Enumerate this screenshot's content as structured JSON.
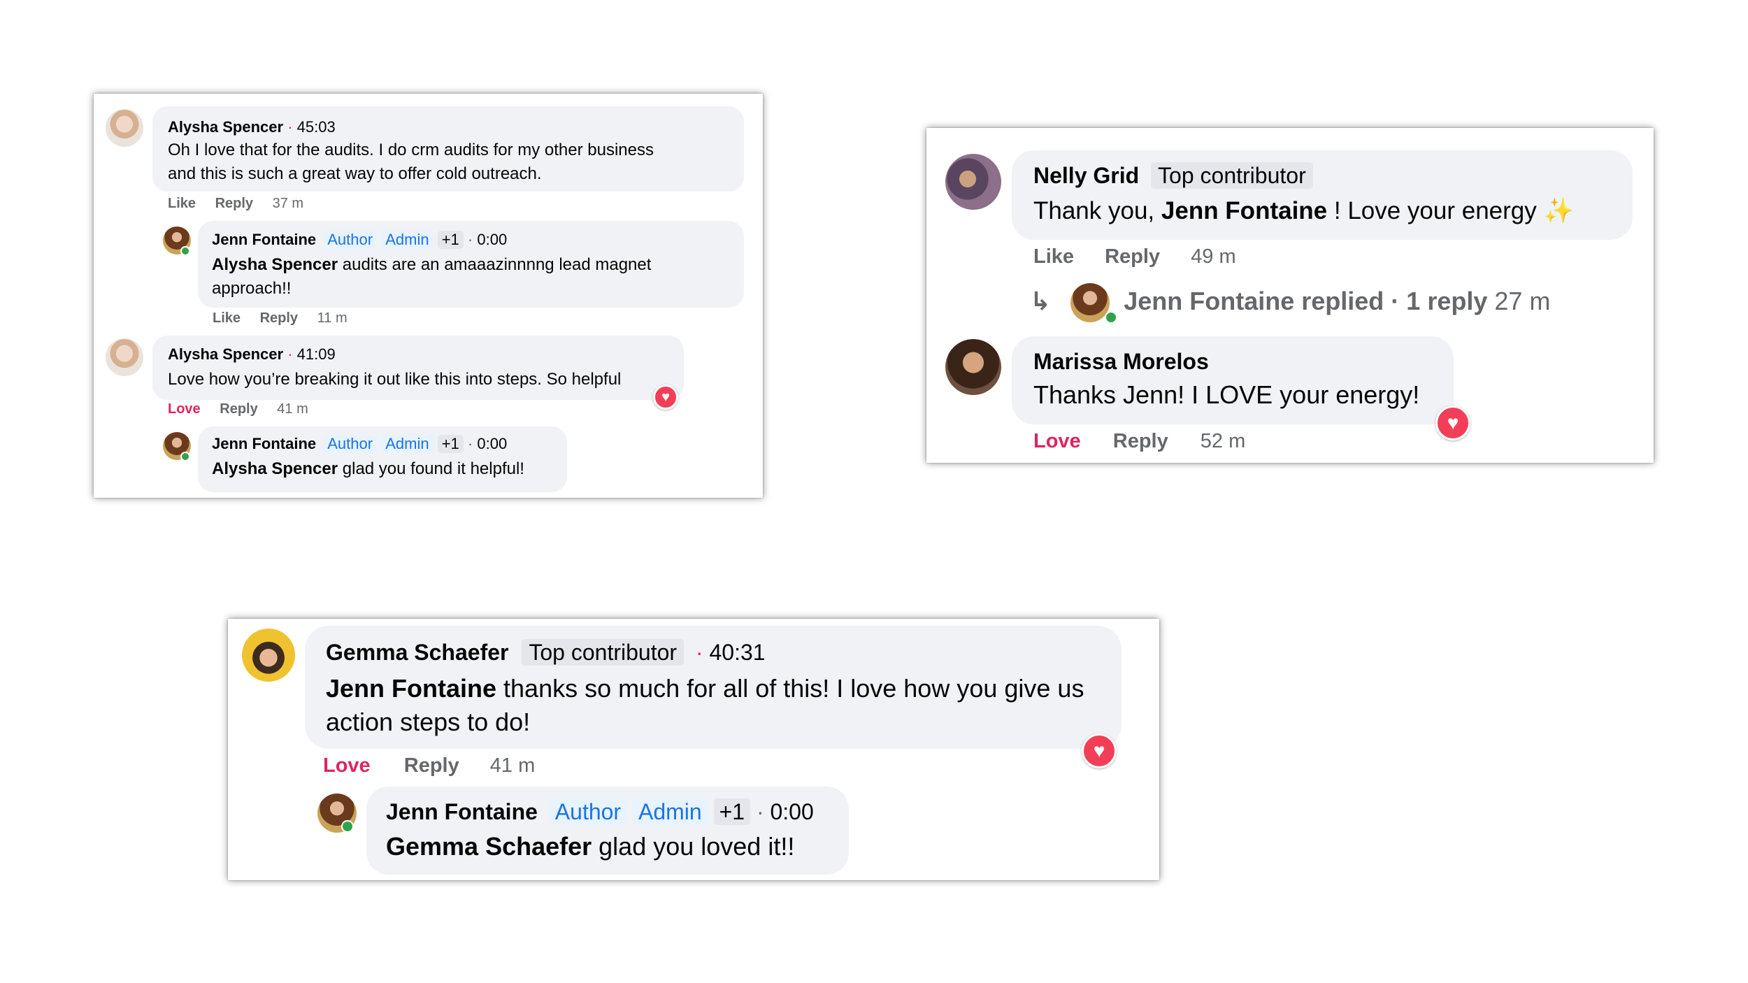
{
  "card1": {
    "comments": [
      {
        "author": "Alysha Spencer",
        "sep": "·",
        "timestamp": "45:03",
        "line1": "Oh I love that for the audits. I do crm audits for my other business",
        "line2": "and this is such a great way to offer cold outreach.",
        "actions": {
          "react": "Like",
          "reply": "Reply",
          "age": "37 m"
        }
      },
      {
        "author": "Jenn Fontaine",
        "badges": [
          "Author",
          "Admin",
          "+1"
        ],
        "sep": "·",
        "timestamp": "0:00",
        "mention": "Alysha Spencer",
        "text_after_mention": " audits are an amaaazinnnng lead magnet",
        "line2": "approach!!",
        "actions": {
          "react": "Like",
          "reply": "Reply",
          "age": "11 m"
        }
      },
      {
        "author": "Alysha Spencer",
        "sep": "·",
        "timestamp": "41:09",
        "line1": "Love how you’re breaking it out like this into steps. So helpful",
        "reaction": "love",
        "actions": {
          "react": "Love",
          "reply": "Reply",
          "age": "41 m"
        }
      },
      {
        "author": "Jenn Fontaine",
        "badges": [
          "Author",
          "Admin",
          "+1"
        ],
        "sep": "·",
        "timestamp": "0:00",
        "mention": "Alysha Spencer",
        "text_after_mention": " glad you found it helpful!"
      }
    ]
  },
  "card2": {
    "comments": [
      {
        "author": "Nelly Grid",
        "badge": "Top contributor",
        "text_before": "Thank you, ",
        "mention": "Jenn Fontaine",
        "text_after": " ! Love your energy ✨",
        "actions": {
          "react": "Like",
          "reply": "Reply",
          "age": "49 m"
        },
        "replies_summary": {
          "name": "Jenn Fontaine replied",
          "sep": "·",
          "count": "1 reply",
          "age": "27 m"
        }
      },
      {
        "author": "Marissa Morelos",
        "text": "Thanks Jenn! I LOVE your energy!",
        "reaction": "love",
        "actions": {
          "react": "Love",
          "reply": "Reply",
          "age": "52 m"
        }
      }
    ]
  },
  "card3": {
    "comments": [
      {
        "author": "Gemma Schaefer",
        "badge": "Top contributor",
        "sep": "·",
        "timestamp": "40:31",
        "mention": "Jenn Fontaine",
        "text_after_mention": " thanks so much for all of this! I love how you give us",
        "line2": "action steps to do!",
        "reaction": "love",
        "actions": {
          "react": "Love",
          "reply": "Reply",
          "age": "41 m"
        }
      },
      {
        "author": "Jenn Fontaine",
        "badges": [
          "Author",
          "Admin",
          "+1"
        ],
        "sep": "·",
        "timestamp": "0:00",
        "mention": "Gemma Schaefer",
        "text_after_mention": " glad you loved it!!"
      }
    ]
  },
  "colors": {
    "bubble": "#f0f2f5",
    "badge_blue_bg": "#e7f3ff",
    "badge_blue_text": "#1b74e4",
    "love_red": "#e0245e",
    "heart": "#f33e58",
    "meta_gray": "#65676b",
    "online_green": "#31a24c"
  },
  "icons": {
    "heart": "♥",
    "reply_arrow": "↳",
    "sparkles": "sparkles-emoji"
  }
}
